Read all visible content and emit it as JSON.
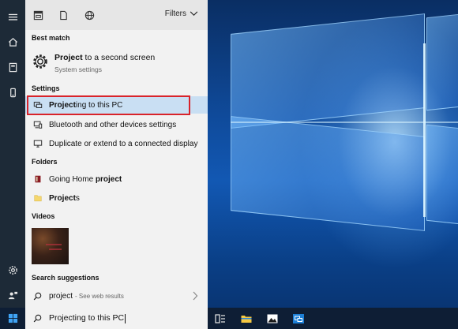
{
  "search_panel": {
    "filters_label": "Filters",
    "sections": {
      "best_match": "Best match",
      "settings": "Settings",
      "folders": "Folders",
      "videos": "Videos",
      "search_suggestions": "Search suggestions"
    },
    "best_match": {
      "title_bold": "Project",
      "title_rest": " to a second screen",
      "subtitle": "System settings"
    },
    "settings_items": [
      {
        "bold": "Project",
        "rest": "ing to this PC",
        "icon": "projector-icon",
        "selected": true
      },
      {
        "bold": "",
        "rest": "Bluetooth and other devices settings",
        "icon": "devices-icon",
        "selected": false
      },
      {
        "bold": "",
        "rest": "Duplicate or extend to a connected display",
        "icon": "monitor-icon",
        "selected": false
      }
    ],
    "folder_items": [
      {
        "pre": "Going Home ",
        "bold": "project",
        "rest": ""
      },
      {
        "pre": "",
        "bold": "Project",
        "rest": "s"
      }
    ],
    "suggestion": {
      "query": "project",
      "suffix": "- See web results"
    }
  },
  "search_box": {
    "value": "Projecting to this PC"
  },
  "colors": {
    "highlight": "#c9dff3",
    "annotation_red": "#d9232a",
    "taskbar": "#0e1e35"
  }
}
